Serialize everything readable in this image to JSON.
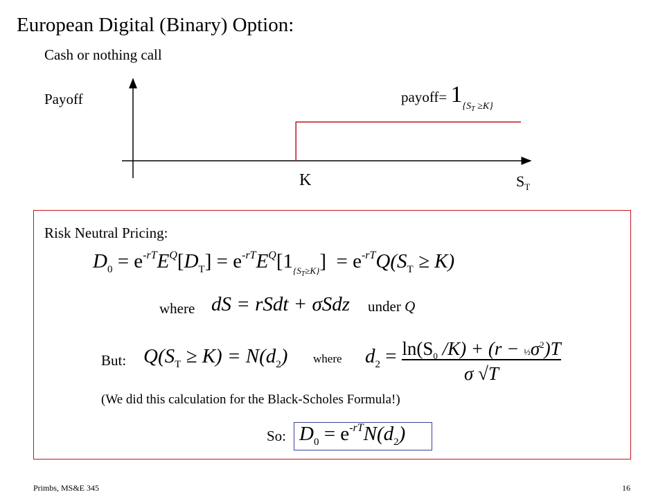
{
  "slide": {
    "title": "European Digital (Binary) Option:",
    "subtitle": "Cash or nothing call",
    "payoff_axis_label": "Payoff",
    "payoff_formula": {
      "prefix": "payoff=",
      "indicator": "1",
      "condition_s": "{S",
      "condition_sub": "T",
      "condition_rest": " ≥K}"
    },
    "strike_label": "K",
    "x_axis_label": "S",
    "x_axis_label_sub": "T",
    "payoff_diagram": {
      "strike_fraction": 0.42,
      "payoff_level": 1,
      "line_color": "#c0141e"
    },
    "risk_neutral": {
      "heading": "Risk Neutral Pricing:",
      "eq1": "D₀ = e^{-rT} E^Q[D_T] = e^{-rT} E^Q[1_{S_T ≥ K}] = e^{-rT} Q(S_T ≥ K)",
      "eq1_parts": {
        "d": "D",
        "d_sub": "0",
        "eq": " = e",
        "exp": "-rT",
        "eQ": "E",
        "eQ_sup": "Q",
        "bracket_open": "[",
        "dt": "D",
        "dt_sub": "T",
        "bracket_close": "]",
        "eq2": " = e",
        "one": "[1",
        "cond": "{S",
        "cond_sub": "T",
        "cond_rest": "≥K}",
        "close2": "]",
        "eq3": "  = e",
        "q": "Q(S",
        "q_sub": "T",
        "q_rest": " ≥ K)"
      },
      "where_label": "where",
      "sde": "dS = rSdt + σSdz",
      "under_label": "under",
      "measure": "Q",
      "but_label": "But:",
      "q_eq": {
        "lhs": "Q(S",
        "sub": "T",
        "rhs": " ≥ K) = N(d",
        "d_sub": "2",
        "end": ")"
      },
      "where_label_2": "where",
      "d2": {
        "lhs": "d",
        "lhs_sub": "2",
        "eq": " =",
        "num_a": "ln(S",
        "num_sub": "0",
        "num_b": " /K) + (r − ",
        "half": "½",
        "num_c": "σ",
        "num_sup": "2",
        "num_d": ")T",
        "den": "σ √T"
      },
      "note": "(We did this calculation for the Black-Scholes Formula!)",
      "so_label": "So:",
      "result": {
        "d": "D",
        "d_sub": "0",
        "eq": " = e",
        "exp": "-rT",
        "rest": "N(d",
        "rest_sub": "2",
        "end": ")"
      },
      "box_color": "#c0141e",
      "result_box_color": "#3f3f99"
    },
    "footer": {
      "left": "Primbs, MS&E 345",
      "page_number": "16"
    }
  }
}
